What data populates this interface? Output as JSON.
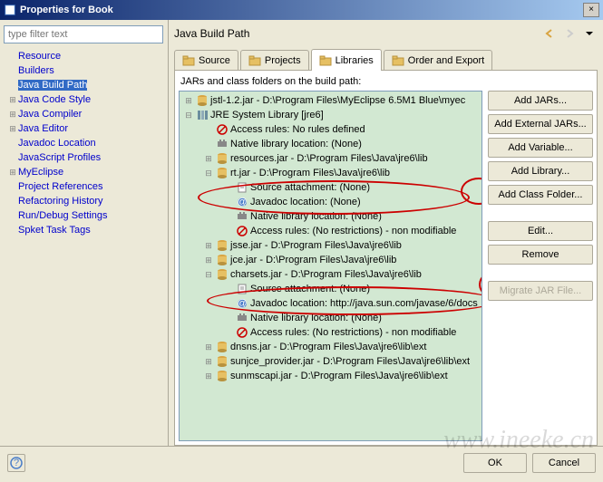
{
  "window": {
    "title": "Properties for Book"
  },
  "filter": {
    "placeholder": "type filter text"
  },
  "nav": {
    "items": [
      {
        "label": "Resource",
        "expandable": false
      },
      {
        "label": "Builders",
        "expandable": false
      },
      {
        "label": "Java Build Path",
        "expandable": false,
        "selected": true
      },
      {
        "label": "Java Code Style",
        "expandable": true
      },
      {
        "label": "Java Compiler",
        "expandable": true
      },
      {
        "label": "Java Editor",
        "expandable": true
      },
      {
        "label": "Javadoc Location",
        "expandable": false
      },
      {
        "label": "JavaScript Profiles",
        "expandable": false
      },
      {
        "label": "MyEclipse",
        "expandable": true
      },
      {
        "label": "Project References",
        "expandable": false
      },
      {
        "label": "Refactoring History",
        "expandable": false
      },
      {
        "label": "Run/Debug Settings",
        "expandable": false
      },
      {
        "label": "Spket Task Tags",
        "expandable": false
      }
    ]
  },
  "page": {
    "heading": "Java Build Path",
    "tabs": [
      {
        "label": "Source"
      },
      {
        "label": "Projects"
      },
      {
        "label": "Libraries",
        "active": true
      },
      {
        "label": "Order and Export"
      }
    ],
    "jars_label": "JARs and class folders on the build path:",
    "tree": [
      {
        "depth": 1,
        "exp": "+",
        "icon": "jar",
        "text": "jstl-1.2.jar - D:\\Program Files\\MyEclipse 6.5M1 Blue\\myec"
      },
      {
        "depth": 1,
        "exp": "-",
        "icon": "lib",
        "text": "JRE System Library [jre6]"
      },
      {
        "depth": 2,
        "exp": "",
        "icon": "acc",
        "text": "Access rules: No rules defined"
      },
      {
        "depth": 2,
        "exp": "",
        "icon": "nat",
        "text": "Native library location: (None)"
      },
      {
        "depth": 2,
        "exp": "+",
        "icon": "jar",
        "text": "resources.jar - D:\\Program Files\\Java\\jre6\\lib"
      },
      {
        "depth": 2,
        "exp": "-",
        "icon": "jar",
        "text": "rt.jar - D:\\Program Files\\Java\\jre6\\lib"
      },
      {
        "depth": 3,
        "exp": "",
        "icon": "src",
        "text": "Source attachment: (None)"
      },
      {
        "depth": 3,
        "exp": "",
        "icon": "jdoc",
        "text": "Javadoc location: (None)"
      },
      {
        "depth": 3,
        "exp": "",
        "icon": "nat",
        "text": "Native library location: (None)"
      },
      {
        "depth": 3,
        "exp": "",
        "icon": "acc",
        "text": "Access rules: (No restrictions) - non modifiable"
      },
      {
        "depth": 2,
        "exp": "+",
        "icon": "jar",
        "text": "jsse.jar - D:\\Program Files\\Java\\jre6\\lib"
      },
      {
        "depth": 2,
        "exp": "+",
        "icon": "jar",
        "text": "jce.jar - D:\\Program Files\\Java\\jre6\\lib"
      },
      {
        "depth": 2,
        "exp": "-",
        "icon": "jar",
        "text": "charsets.jar - D:\\Program Files\\Java\\jre6\\lib"
      },
      {
        "depth": 3,
        "exp": "",
        "icon": "src",
        "text": "Source attachment: (None)"
      },
      {
        "depth": 3,
        "exp": "",
        "icon": "jdoc",
        "text": "Javadoc location: http://java.sun.com/javase/6/docs"
      },
      {
        "depth": 3,
        "exp": "",
        "icon": "nat",
        "text": "Native library location: (None)"
      },
      {
        "depth": 3,
        "exp": "",
        "icon": "acc",
        "text": "Access rules: (No restrictions) - non modifiable"
      },
      {
        "depth": 2,
        "exp": "+",
        "icon": "jar",
        "text": "dnsns.jar - D:\\Program Files\\Java\\jre6\\lib\\ext"
      },
      {
        "depth": 2,
        "exp": "+",
        "icon": "jar",
        "text": "sunjce_provider.jar - D:\\Program Files\\Java\\jre6\\lib\\ext"
      },
      {
        "depth": 2,
        "exp": "+",
        "icon": "jar",
        "text": "sunmscapi.jar - D:\\Program Files\\Java\\jre6\\lib\\ext"
      }
    ]
  },
  "buttons": {
    "add_jars": "Add JARs...",
    "add_external": "Add External JARs...",
    "add_variable": "Add Variable...",
    "add_library": "Add Library...",
    "add_class_folder": "Add Class Folder...",
    "edit": "Edit...",
    "remove": "Remove",
    "migrate": "Migrate JAR File..."
  },
  "footer": {
    "ok": "OK",
    "cancel": "Cancel"
  },
  "watermark": "www.ineeke.cn"
}
